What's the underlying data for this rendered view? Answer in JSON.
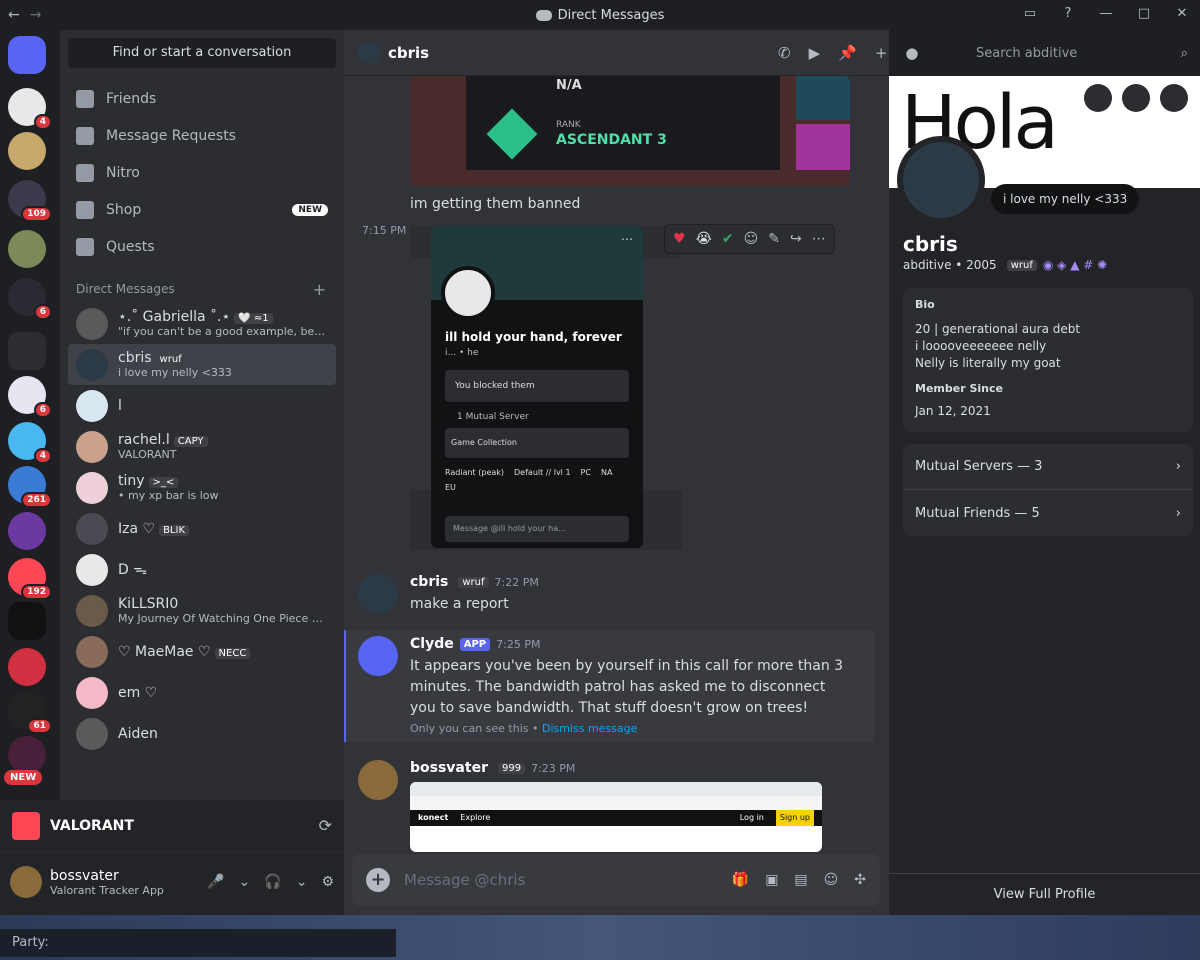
{
  "window": {
    "title": "Direct Messages"
  },
  "sidebar": {
    "find": "Find or start a conversation",
    "nav": [
      {
        "label": "Friends"
      },
      {
        "label": "Message Requests"
      },
      {
        "label": "Nitro"
      },
      {
        "label": "Shop",
        "tag": "NEW"
      },
      {
        "label": "Quests"
      }
    ],
    "dm_header": "Direct Messages",
    "dms": [
      {
        "name": "⋆.˚ Gabriella ˚.⋆",
        "tag": "🤍 ≈1",
        "sub": "\"if you can't be a good example, be a h..."
      },
      {
        "name": "cbris",
        "tag": "wruf",
        "sub": "i love my nelly <333"
      },
      {
        "name": "l",
        "tag": "",
        "sub": ""
      },
      {
        "name": "rachel.l",
        "tag": "CAPY",
        "sub": "VALORANT"
      },
      {
        "name": "tiny",
        "tag": ">_<",
        "sub": "• my xp bar is low"
      },
      {
        "name": "Iza ♡",
        "tag": "BLIK",
        "sub": ""
      },
      {
        "name": "D ᯓ",
        "tag": "",
        "sub": ""
      },
      {
        "name": "KiLLSRI0",
        "tag": "",
        "sub": "My Journey Of Watching One Piece S2 ..."
      },
      {
        "name": "♡ MaeMae ♡",
        "tag": "NECC",
        "sub": ""
      },
      {
        "name": "em ♡",
        "tag": "",
        "sub": ""
      },
      {
        "name": "Aiden",
        "tag": "",
        "sub": ""
      }
    ]
  },
  "guilds": {
    "badges": [
      "4",
      "109",
      "6",
      "6",
      "4",
      "261",
      "192",
      "61"
    ],
    "new_label": "NEW"
  },
  "activity": {
    "label": "VALORANT"
  },
  "user": {
    "name": "bossvater",
    "status": "Valorant Tracker App"
  },
  "chat": {
    "channel_name": "cbris",
    "search_placeholder": "Search abditive",
    "rank_na": "N/A",
    "rank_label": "RANK",
    "rank_value": "ASCENDANT 3",
    "msg_banned": "im getting them banned",
    "time_715": "7:15 PM",
    "popup": {
      "title": "ill hold your hand, forever",
      "sub": "i... • he",
      "blocked": "You blocked them",
      "mutual": "1 Mutual Server",
      "server": "Game Collection",
      "roles": [
        "Radiant (peak)",
        "Default // lvl 1",
        "PC",
        "NA",
        "EU"
      ],
      "message_ph": "Message @ill hold your ha..."
    },
    "messages": [
      {
        "author": "cbris",
        "tag": "wruf",
        "time": "7:22 PM",
        "text": "make a report"
      },
      {
        "author": "Clyde",
        "tag": "APP",
        "time": "7:25 PM",
        "text": "It appears you've been by yourself in this call for more than 3 minutes. The bandwidth patrol has asked me to disconnect you to save bandwidth. That stuff doesn't grow on trees!",
        "note": "Only you can see this •",
        "dismiss": "Dismiss message"
      },
      {
        "author": "bossvater",
        "tag": "999",
        "time": "7:23 PM",
        "text": ""
      }
    ],
    "composer_placeholder": "Message @chris",
    "embed_brand": "konect",
    "embed_nav": "Explore",
    "embed_login": "Log in",
    "embed_signup": "Sign up"
  },
  "profile": {
    "banner_text": "Hola",
    "status": "i love my nelly <333",
    "display_name": "cbris",
    "username": "abditive • 2005",
    "tag": "wruf",
    "bio_title": "Bio",
    "bio": [
      "20 | generational aura debt",
      "i looooveeeeeee nelly",
      "Nelly is literally my goat"
    ],
    "member_since_title": "Member Since",
    "member_since": "Jan 12, 2021",
    "mutual_servers": "Mutual Servers — 3",
    "mutual_friends": "Mutual Friends — 5",
    "view_full": "View Full Profile"
  },
  "taskbar": {
    "party_label": "Party:"
  }
}
